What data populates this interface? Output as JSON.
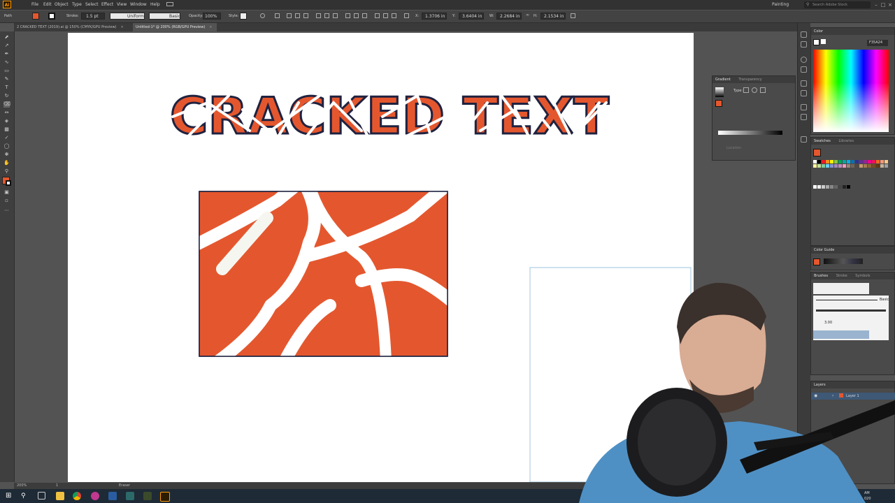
{
  "app": {
    "logo": "Ai",
    "workspace": "Painting",
    "search_placeholder": "Search Adobe Stock"
  },
  "menu": [
    "File",
    "Edit",
    "Object",
    "Type",
    "Select",
    "Effect",
    "View",
    "Window",
    "Help"
  ],
  "control_bar": {
    "selection": "Path",
    "stroke_label": "Stroke:",
    "stroke_value": "1.5 pt",
    "profile": "Uniform",
    "brush": "Basic",
    "opacity_label": "Opacity:",
    "opacity_value": "100%",
    "style_label": "Style:",
    "x_label": "X:",
    "x_value": "1.3706 in",
    "y_label": "Y:",
    "y_value": "3.6404 in",
    "w_label": "W:",
    "w_value": "2.2684 in",
    "h_label": "H:",
    "h_value": "2.1534 in"
  },
  "tabs": [
    {
      "label": "2 CRACKED TEXT (2019).ai @ 150% (CMYK/GPU Preview)",
      "active": false
    },
    {
      "label": "Untitled-1* @ 200% (RGB/GPU Preview)",
      "active": true
    }
  ],
  "artwork": {
    "headline": "CRACKED TEXT"
  },
  "panels": {
    "color": {
      "title": "Color",
      "hex": "F35A24"
    },
    "gradient": {
      "tabs": [
        "Gradient",
        "Transparency"
      ],
      "type_label": "Type:",
      "location_label": "Location"
    },
    "swatches": {
      "tabs": [
        "Swatches",
        "Libraries"
      ]
    },
    "color_guide": {
      "title": "Color Guide"
    },
    "brushes": {
      "tabs": [
        "Brushes",
        "Stroke",
        "Symbols"
      ],
      "basic": "Basic",
      "size": "3.00"
    },
    "layers": {
      "title": "Layers",
      "layer_name": "Layer 1"
    }
  },
  "status": {
    "zoom": "200%",
    "page": "1",
    "tool": "Eraser"
  },
  "clock": {
    "time": "AM",
    "date": "020"
  },
  "colors": {
    "accent": "#e4572e",
    "ui_dark": "#535353",
    "panel": "#4a4a4a"
  }
}
